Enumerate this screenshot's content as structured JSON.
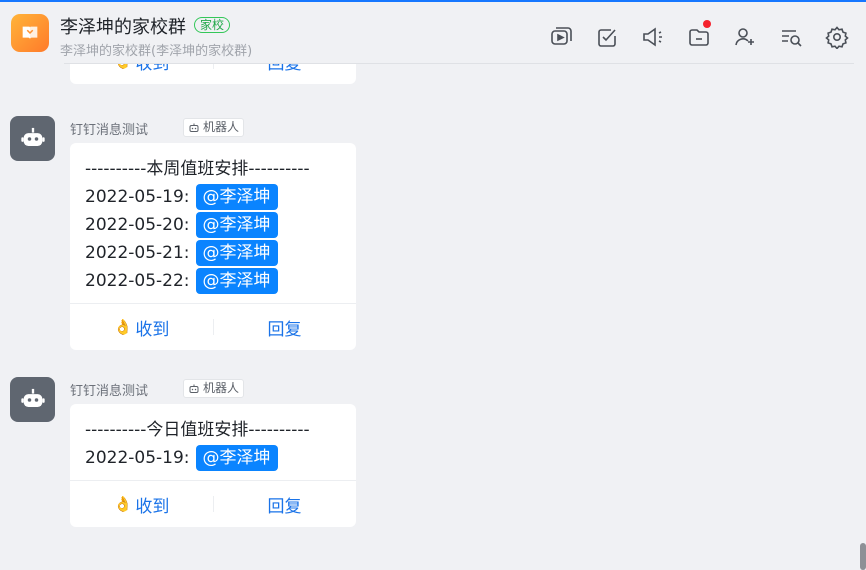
{
  "header": {
    "title": "李泽坤的家校群",
    "badge": "家校",
    "subtitle": "李泽坤的家校群(李泽坤的家校群)",
    "tools": [
      "video-icon",
      "task-check-icon",
      "announcement-icon",
      "folder-icon",
      "add-member-icon",
      "search-messages-icon",
      "settings-icon"
    ],
    "accent_color": "#1677ff"
  },
  "actions": {
    "ack_label": "收到",
    "reply_label": "回复"
  },
  "messages": [
    {
      "sender": "钉钉消息测试",
      "tag": "机器人",
      "lines": [
        {
          "text": "----------本周值班安排----------"
        },
        {
          "date": "2022-05-19:",
          "mention": "@李泽坤"
        },
        {
          "date": "2022-05-20:",
          "mention": "@李泽坤"
        },
        {
          "date": "2022-05-21:",
          "mention": "@李泽坤"
        },
        {
          "date": "2022-05-22:",
          "mention": "@李泽坤"
        }
      ]
    },
    {
      "sender": "钉钉消息测试",
      "tag": "机器人",
      "lines": [
        {
          "text": "----------今日值班安排----------"
        },
        {
          "date": "2022-05-19:",
          "mention": "@李泽坤"
        }
      ]
    }
  ]
}
